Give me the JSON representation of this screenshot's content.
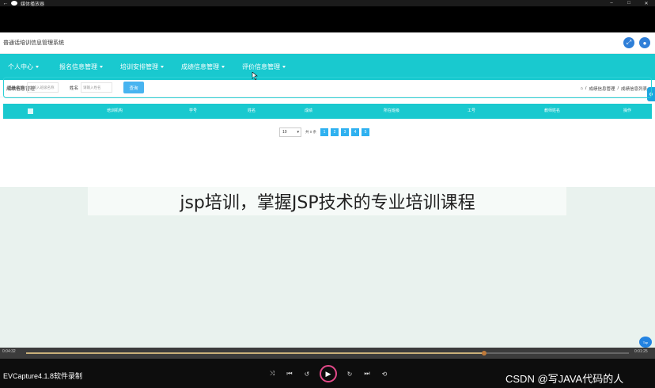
{
  "player": {
    "window_title": "媒体播放器",
    "app_name": "EVCapture4.1.8软件录制",
    "time_current": "0:04:32",
    "time_total": "0:01:25",
    "progress_fraction": 0.76,
    "watermark": "CSDN @写JAVA代码的人",
    "subtitle": "jsp培训，掌握JSP技术的专业培训课程",
    "top_button": "Top",
    "window_controls": [
      "–",
      "□",
      "✕"
    ]
  },
  "app": {
    "title": "普通话培训信息管理系统",
    "nav": [
      "个人中心",
      "报名信息管理",
      "培训安排管理",
      "成绩信息管理",
      "评价信息管理"
    ],
    "page_title": "成绩信息管理",
    "breadcrumbs": [
      "⌂",
      "/",
      "成绩信息管理",
      "/",
      "成绩信息列表"
    ],
    "search": {
      "label1": "班级名称",
      "placeholder1": "请输入班级名称",
      "label2": "姓名",
      "placeholder2": "请输入姓名",
      "button": "查询"
    },
    "table_headers": [
      "培训机构",
      "学号",
      "姓名",
      "成绩",
      "所在班级",
      "工号",
      "教师姓名",
      "操作"
    ],
    "pager": {
      "page_size": "10",
      "total": "共 0 条",
      "pages": [
        "1",
        "2",
        "3",
        "4",
        "5"
      ]
    }
  },
  "colors": {
    "accent": "#19c9cf",
    "button": "#48b4f0",
    "progress_knob": "#c07a3a",
    "play_ring": "#e44a8a"
  }
}
